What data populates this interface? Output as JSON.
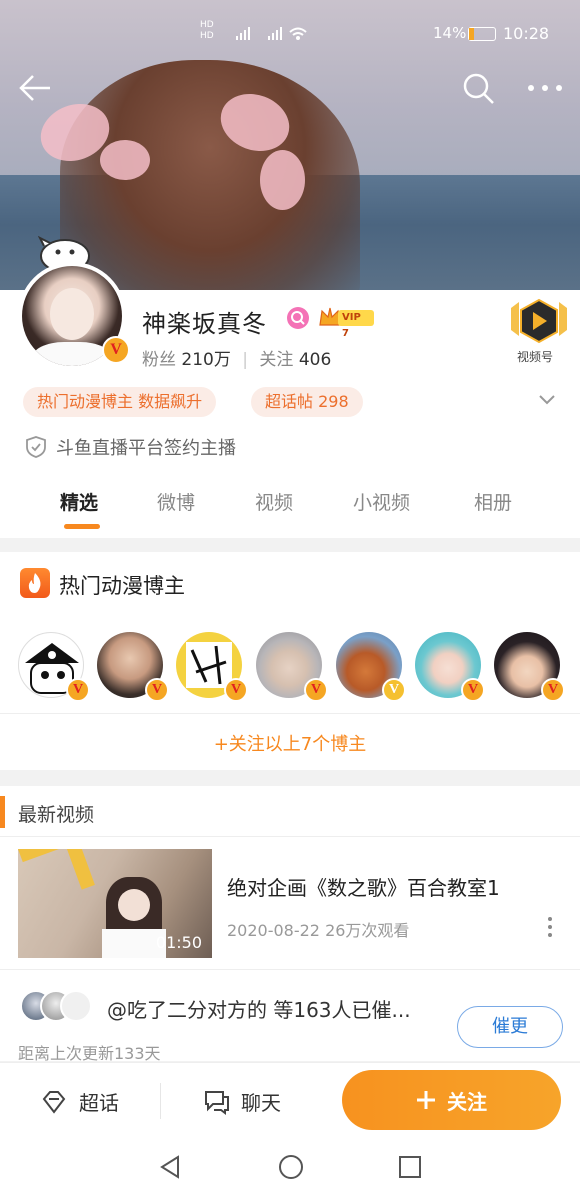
{
  "status_bar": {
    "battery": "14%",
    "time": "10:28"
  },
  "profile": {
    "name": "神楽坂真冬",
    "vip_label": "VIP 7",
    "fans_label": "粉丝",
    "fans_count": "210万",
    "follow_label": "关注",
    "follow_count": "406",
    "video_label": "视频号",
    "tags": [
      "热门动漫博主 数据飙升",
      "超话帖 298"
    ],
    "verification": "斗鱼直播平台签约主播"
  },
  "tabs": [
    "精选",
    "微博",
    "视频",
    "小视频",
    "相册"
  ],
  "bloggers": {
    "title": "热门动漫博主",
    "follow_all": "+关注以上7个博主"
  },
  "latest_video": {
    "section_title": "最新视频",
    "title": "绝对企画《数之歌》百合教室1",
    "duration": "01:50",
    "meta": "2020-08-22 26万次观看"
  },
  "urge": {
    "text": "@吃了二分对方的 等163人已催...",
    "button": "催更",
    "since_update": "距离上次更新133天"
  },
  "bottom_bar": {
    "super_topic": "超话",
    "chat": "聊天",
    "follow": "关注"
  },
  "colors": {
    "accent": "#f7881f",
    "tag_text": "#ec6f2d",
    "link_blue": "#2b7bd6"
  }
}
